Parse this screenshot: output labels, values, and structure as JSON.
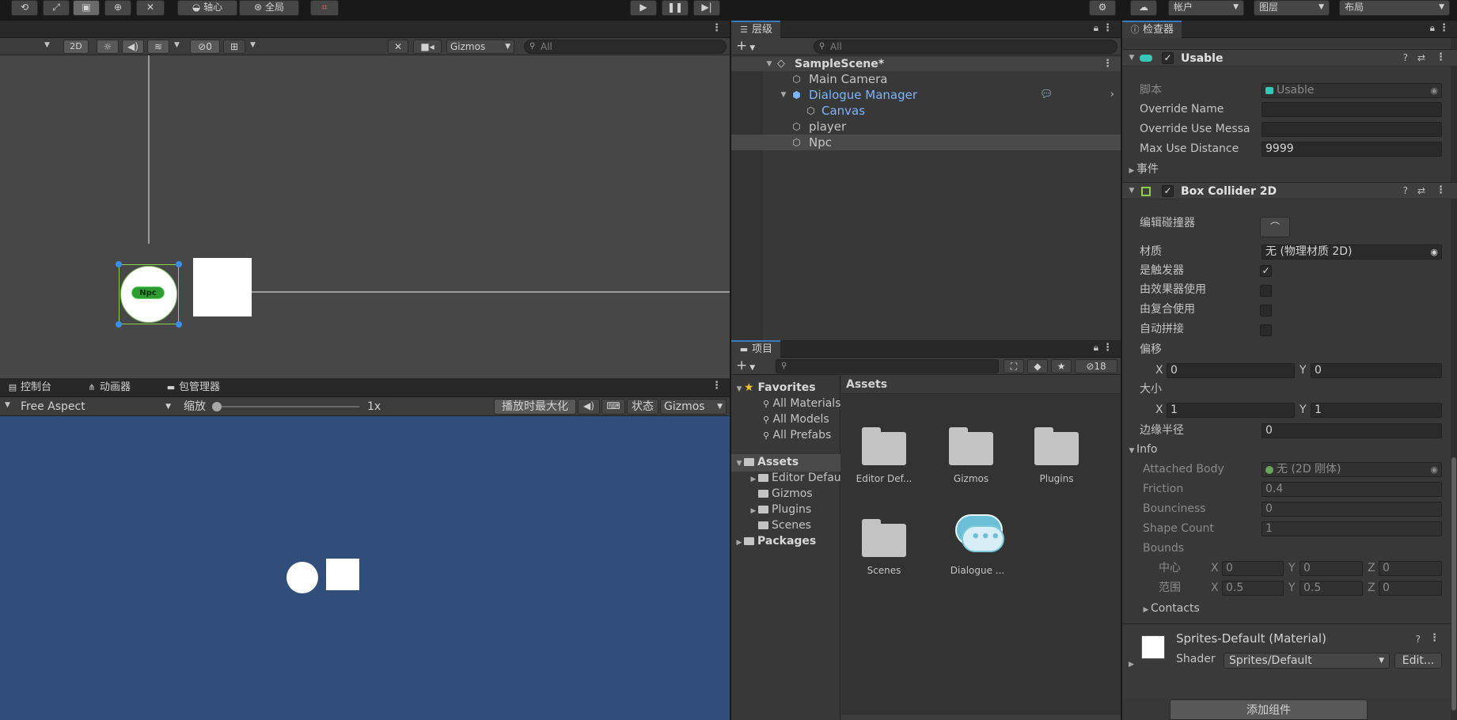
{
  "top_toolbar": {
    "pivot_label": "轴心",
    "global_label": "全局",
    "account_label": "帐户",
    "layers_label": "图层",
    "layout_label": "布局"
  },
  "scene_view": {
    "mode_2d": "2D",
    "hidden_count": "0",
    "gizmos_label": "Gizmos",
    "search_placeholder": "All",
    "npc_label": "Npc"
  },
  "bottom_tabs": {
    "console": "控制台",
    "animator": "动画器",
    "package_manager": "包管理器"
  },
  "game_view": {
    "aspect": "Free Aspect",
    "scale_label": "缩放",
    "scale_value": "1x",
    "maximize_label": "播放时最大化",
    "stats_label": "状态",
    "gizmos_label": "Gizmos"
  },
  "hierarchy": {
    "tab_label": "层级",
    "search_placeholder": "All",
    "scene_name": "SampleScene*",
    "items": [
      {
        "label": "Main Camera"
      },
      {
        "label": "Dialogue Manager"
      },
      {
        "label": "Canvas"
      },
      {
        "label": "player"
      },
      {
        "label": "Npc"
      }
    ]
  },
  "project": {
    "tab_label": "项目",
    "hidden_count": "18",
    "favorites_label": "Favorites",
    "favorites": [
      "All Materials",
      "All Models",
      "All Prefabs"
    ],
    "assets_label": "Assets",
    "asset_folders": [
      "Editor Default Resources",
      "Gizmos",
      "Plugins",
      "Scenes"
    ],
    "packages_label": "Packages",
    "breadcrumb": "Assets",
    "grid_items": [
      {
        "label": "Editor Def..."
      },
      {
        "label": "Gizmos"
      },
      {
        "label": "Plugins"
      },
      {
        "label": "Scenes"
      },
      {
        "label": "Dialogue ..."
      }
    ]
  },
  "inspector": {
    "tab_label": "检查器",
    "usable": {
      "title": "Usable",
      "script_label": "脚本",
      "script_value": "Usable",
      "override_name_label": "Override Name",
      "override_name_value": "",
      "override_use_label": "Override Use Messa",
      "override_use_value": "",
      "max_use_label": "Max Use Distance",
      "max_use_value": "9999",
      "events_label": "事件"
    },
    "box_collider": {
      "title": "Box Collider 2D",
      "edit_collider_label": "编辑碰撞器",
      "material_label": "材质",
      "material_value": "无 (物理材质 2D)",
      "is_trigger_label": "是触发器",
      "used_by_effector_label": "由效果器使用",
      "used_by_composite_label": "由复合使用",
      "auto_tiling_label": "自动拼接",
      "offset_label": "偏移",
      "offset_x": "0",
      "offset_y": "0",
      "size_label": "大小",
      "size_x": "1",
      "size_y": "1",
      "edge_radius_label": "边缘半径",
      "edge_radius_value": "0",
      "info_label": "Info",
      "attached_body_label": "Attached Body",
      "attached_body_value": "无 (2D 刚体)",
      "friction_label": "Friction",
      "friction_value": "0.4",
      "bounciness_label": "Bounciness",
      "bounciness_value": "0",
      "shape_count_label": "Shape Count",
      "shape_count_value": "1",
      "bounds_label": "Bounds",
      "center_label": "中心",
      "center_x": "0",
      "center_y": "0",
      "center_z": "0",
      "extent_label": "范围",
      "extent_x": "0.5",
      "extent_y": "0.5",
      "extent_z": "0",
      "contacts_label": "Contacts"
    },
    "material": {
      "name": "Sprites-Default (Material)",
      "shader_label": "Shader",
      "shader_value": "Sprites/Default",
      "edit_label": "Edit..."
    },
    "add_component_label": "添加组件"
  },
  "axis_letters": {
    "x": "X",
    "y": "Y",
    "z": "Z"
  },
  "colors": {
    "accent_blue": "#3a79bb",
    "game_background": "#314d79",
    "prefab_blue": "#7cb4ff",
    "collider_green": "#8fd04b"
  }
}
